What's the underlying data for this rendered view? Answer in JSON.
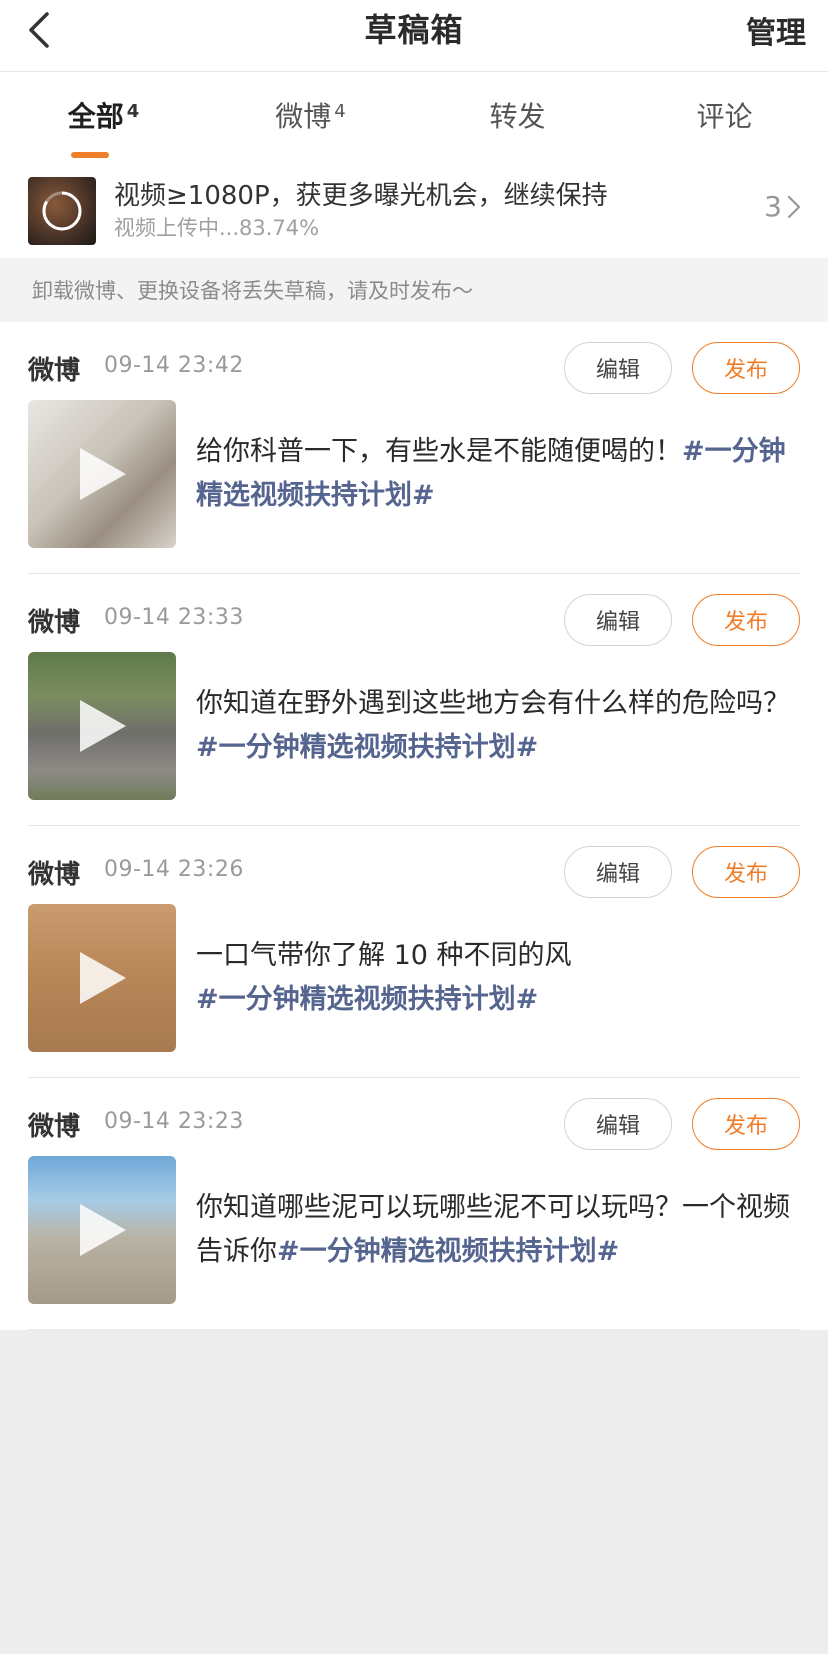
{
  "header": {
    "title": "草稿箱",
    "manage_label": "管理"
  },
  "tabs": [
    {
      "label": "全部",
      "count": "4",
      "active": true
    },
    {
      "label": "微博",
      "count": "4",
      "active": false
    },
    {
      "label": "转发",
      "count": "",
      "active": false
    },
    {
      "label": "评论",
      "count": "",
      "active": false
    }
  ],
  "upload": {
    "title": "视频≥1080P，获更多曝光机会，继续保持",
    "progress_text": "视频上传中...83.74%",
    "progress_percent": 83.74,
    "count": "3"
  },
  "notice": "卸载微博、更换设备将丢失草稿，请及时发布～",
  "drafts": [
    {
      "type": "微博",
      "time": "09-14 23:42",
      "text": "给你科普一下，有些水是不能随便喝的！",
      "tag": "#一分钟精选视频扶持计划#",
      "edit_label": "编辑",
      "publish_label": "发布"
    },
    {
      "type": "微博",
      "time": "09-14 23:33",
      "text": "你知道在野外遇到这些地方会有什么样的危险吗？",
      "tag": "#一分钟精选视频扶持计划#",
      "edit_label": "编辑",
      "publish_label": "发布"
    },
    {
      "type": "微博",
      "time": "09-14 23:26",
      "text": "一口气带你了解 10 种不同的风",
      "tag": "#一分钟精选视频扶持计划#",
      "edit_label": "编辑",
      "publish_label": "发布"
    },
    {
      "type": "微博",
      "time": "09-14 23:23",
      "text": "你知道哪些泥可以玩哪些泥不可以玩吗？一个视频告诉你",
      "tag": "#一分钟精选视频扶持计划#",
      "edit_label": "编辑",
      "publish_label": "发布"
    }
  ],
  "colors": {
    "accent": "#f07d2a",
    "tag": "#55658f",
    "background": "#ededed"
  }
}
